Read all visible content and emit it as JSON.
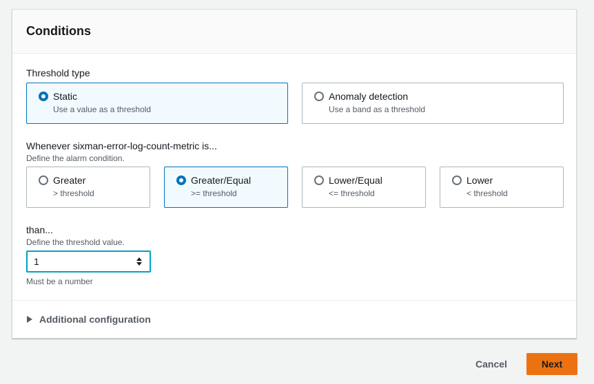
{
  "panel": {
    "title": "Conditions"
  },
  "threshold_type": {
    "label": "Threshold type",
    "options": [
      {
        "label": "Static",
        "description": "Use a value as a threshold",
        "selected": true
      },
      {
        "label": "Anomaly detection",
        "description": "Use a band as a threshold",
        "selected": false
      }
    ]
  },
  "condition": {
    "label": "Whenever sixman-error-log-count-metric is...",
    "description": "Define the alarm condition.",
    "options": [
      {
        "label": "Greater",
        "description": "> threshold",
        "selected": false
      },
      {
        "label": "Greater/Equal",
        "description": ">= threshold",
        "selected": true
      },
      {
        "label": "Lower/Equal",
        "description": "<= threshold",
        "selected": false
      },
      {
        "label": "Lower",
        "description": "< threshold",
        "selected": false
      }
    ]
  },
  "threshold_value": {
    "label": "than...",
    "description": "Define the threshold value.",
    "value": "1",
    "constraint": "Must be a number"
  },
  "additional_config": {
    "label": "Additional configuration",
    "expanded": false
  },
  "footer": {
    "cancel_label": "Cancel",
    "next_label": "Next"
  },
  "colors": {
    "accent": "#0073bb",
    "primary_button": "#ec7211",
    "focus": "#00a1c9"
  }
}
